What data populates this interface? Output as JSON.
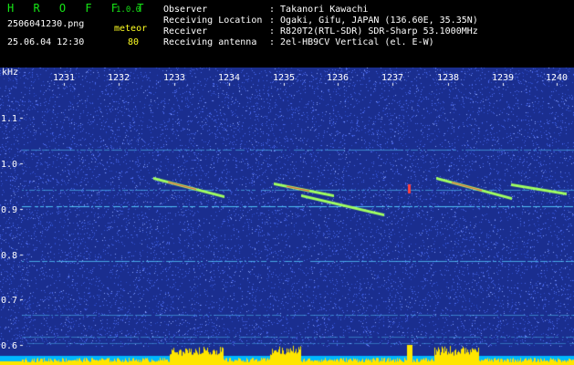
{
  "header": {
    "brand": "H R O F F T",
    "version": "1.0.0",
    "filename": "2506041230.png",
    "mode_label": "meteor",
    "datetime": "25.06.04 12:30",
    "count": "80",
    "info": [
      {
        "label": "Observer",
        "value": ": Takanori Kawachi"
      },
      {
        "label": "Receiving Location",
        "value": ": Ogaki, Gifu, JAPAN (136.60E, 35.35N)"
      },
      {
        "label": "Receiver",
        "value": ": R820T2(RTL-SDR) SDR-Sharp 53.1000MHz"
      },
      {
        "label": "Receiving antenna",
        "value": ": 2el-HB9CV Vertical (el. E-W)"
      }
    ]
  },
  "axes": {
    "y_unit": "kHz",
    "y_ticks": [
      "1.1",
      "1.0",
      "0.9",
      "0.8",
      "0.7",
      "0.6"
    ],
    "x_ticks": [
      "1231",
      "1232",
      "1233",
      "1234",
      "1235",
      "1236",
      "1237",
      "1238",
      "1239",
      "1240"
    ]
  },
  "colors": {
    "background": "#1a2e8f",
    "noise": "#4d6cf0",
    "carrier": "#55d0ff",
    "meteor_core": "#ff4040",
    "meteor_edge": "#a0ff60",
    "level": "#ffe600",
    "baseline": "#00b8ff"
  }
}
